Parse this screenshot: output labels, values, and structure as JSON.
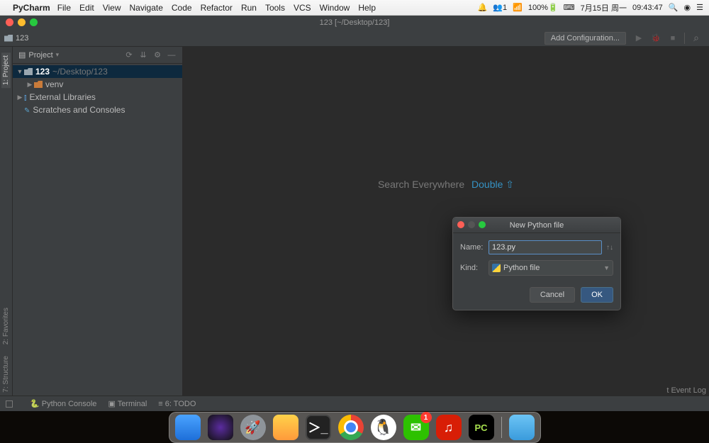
{
  "mac_menu": {
    "app_name": "PyCharm",
    "items": [
      "File",
      "Edit",
      "View",
      "Navigate",
      "Code",
      "Refactor",
      "Run",
      "Tools",
      "VCS",
      "Window",
      "Help"
    ],
    "status": {
      "wechat_count": "1",
      "battery": "100%",
      "date": "7月15日 周一",
      "time": "09:43:47"
    }
  },
  "window_title": "123 [~/Desktop/123]",
  "breadcrumb": "123",
  "toolbar": {
    "add_configuration": "Add Configuration..."
  },
  "sidebar": {
    "title": "Project",
    "tree": {
      "root_name": "123",
      "root_path": "~/Desktop/123",
      "venv": "venv",
      "ext_lib": "External Libraries",
      "scratch": "Scratches and Consoles"
    }
  },
  "left_tabs": {
    "project": "1: Project",
    "favorites": "2: Favorites",
    "structure": "7: Structure"
  },
  "hint": {
    "text": "Search Everywhere",
    "shortcut": "Double"
  },
  "dialog": {
    "title": "New Python file",
    "name_label": "Name:",
    "name_value": "123.py",
    "kind_label": "Kind:",
    "kind_value": "Python file",
    "cancel": "Cancel",
    "ok": "OK"
  },
  "bottom": {
    "python_console": "Python Console",
    "terminal": "Terminal",
    "todo": "6: TODO",
    "event_log": "Event Log"
  },
  "dock_badge_wechat": "1"
}
